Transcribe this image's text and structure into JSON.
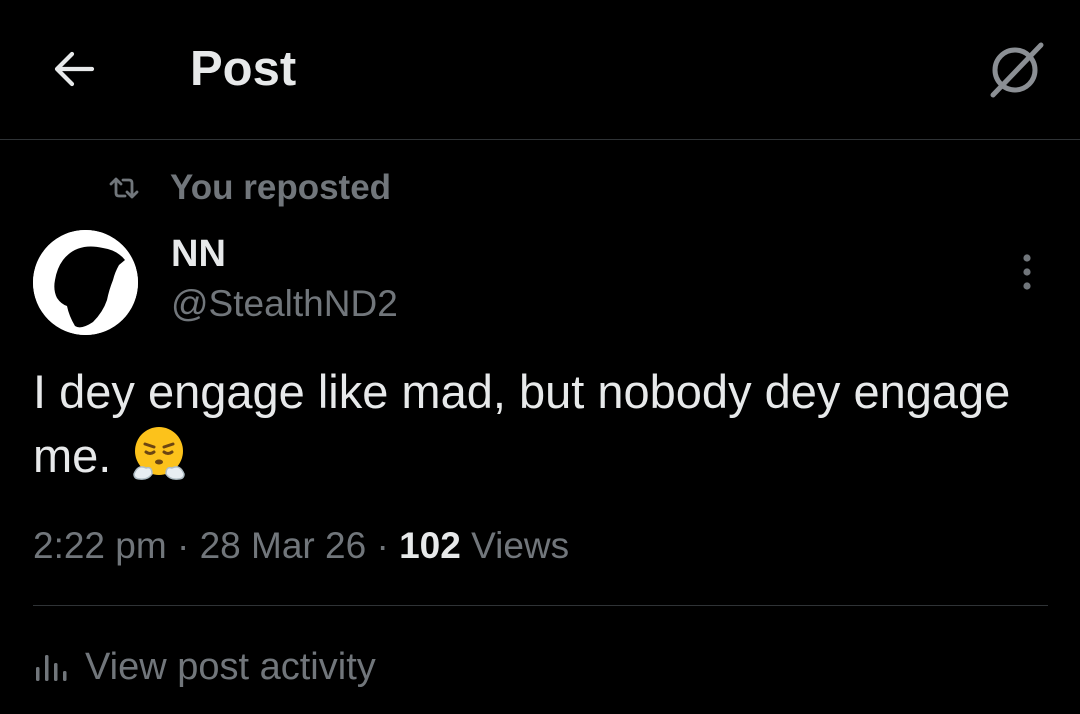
{
  "header": {
    "title": "Post",
    "back_icon": "arrow-left-icon",
    "grok_icon": "grok-icon"
  },
  "social_context": {
    "icon": "repost-icon",
    "text": "You reposted"
  },
  "author": {
    "display_name": "NN",
    "handle": "@StealthND2",
    "avatar_icon": "silhouette-avatar"
  },
  "post": {
    "text": "I dey engage like mad, but nobody dey engage me.",
    "emoji": "face-with-steam-from-nose",
    "emoji_char": "😤"
  },
  "meta": {
    "time": "2:22 pm",
    "sep1": " · ",
    "date": "28 Mar 26",
    "sep2": " · ",
    "views_count": "102",
    "views_label": " Views"
  },
  "activity": {
    "icon": "bar-chart-icon",
    "label": "View post activity"
  },
  "colors": {
    "background": "#000000",
    "primary_text": "#e7e9ea",
    "secondary_text": "#71767b",
    "divider": "#2f3336"
  }
}
